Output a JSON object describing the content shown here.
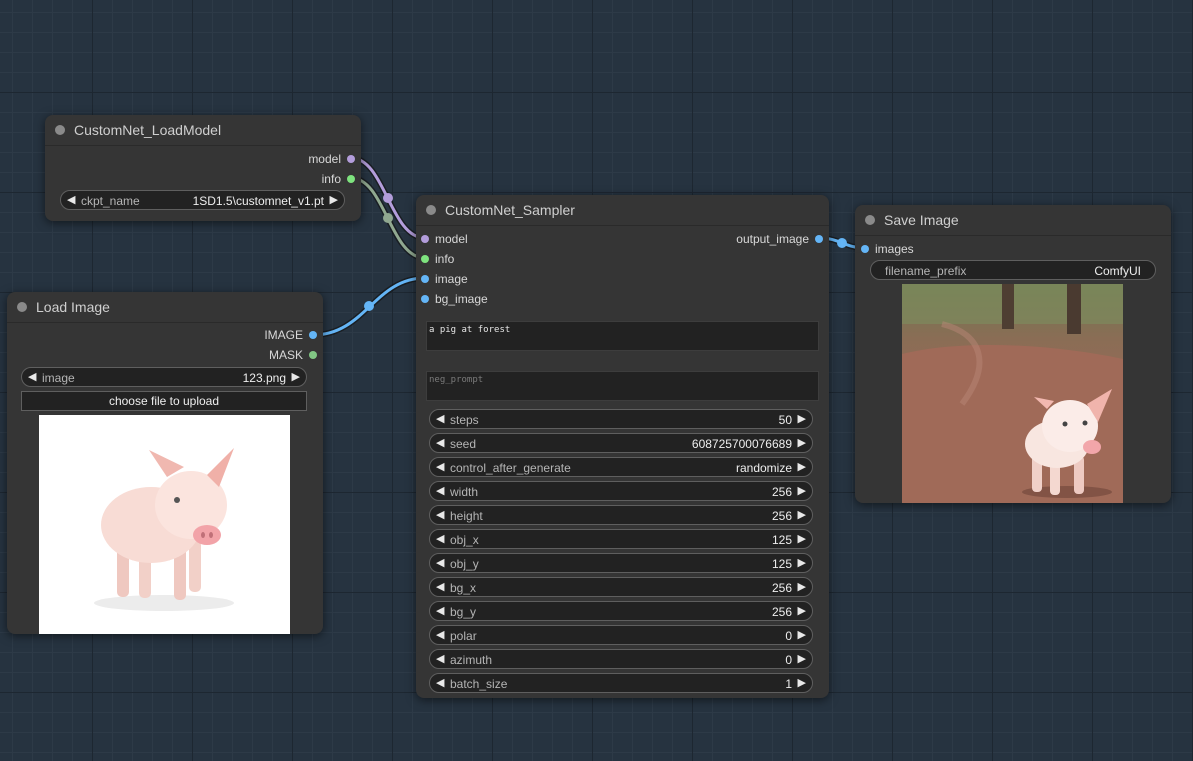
{
  "colors": {
    "model": "#b39ddb",
    "info": "#7ee37e",
    "image": "#64b5f6",
    "mask": "#81c784"
  },
  "nodes": {
    "load_model": {
      "title": "CustomNet_LoadModel",
      "outputs": [
        "model",
        "info"
      ],
      "widgets": [
        {
          "name": "ckpt_name",
          "value": "1SD1.5\\customnet_v1.pt"
        }
      ]
    },
    "load_image": {
      "title": "Load Image",
      "outputs": [
        "IMAGE",
        "MASK"
      ],
      "widgets": [
        {
          "name": "image",
          "value": "123.png"
        }
      ],
      "upload_label": "choose file to upload",
      "preview_icon": "pig-photo-white-background"
    },
    "sampler": {
      "title": "CustomNet_Sampler",
      "inputs": [
        "model",
        "info",
        "image",
        "bg_image"
      ],
      "outputs": [
        "output_image"
      ],
      "prompt": "a pig at forest",
      "neg_prompt_placeholder": "neg_prompt",
      "widgets": [
        {
          "name": "steps",
          "value": "50"
        },
        {
          "name": "seed",
          "value": "608725700076689"
        },
        {
          "name": "control_after_generate",
          "value": "randomize"
        },
        {
          "name": "width",
          "value": "256"
        },
        {
          "name": "height",
          "value": "256"
        },
        {
          "name": "obj_x",
          "value": "125"
        },
        {
          "name": "obj_y",
          "value": "125"
        },
        {
          "name": "bg_x",
          "value": "256"
        },
        {
          "name": "bg_y",
          "value": "256"
        },
        {
          "name": "polar",
          "value": "0"
        },
        {
          "name": "azimuth",
          "value": "0"
        },
        {
          "name": "batch_size",
          "value": "1"
        }
      ]
    },
    "save_image": {
      "title": "Save Image",
      "inputs": [
        "images"
      ],
      "widgets": [
        {
          "name": "filename_prefix",
          "value": "ComfyUI"
        }
      ],
      "preview_icon": "pig-in-forest-photo"
    }
  }
}
